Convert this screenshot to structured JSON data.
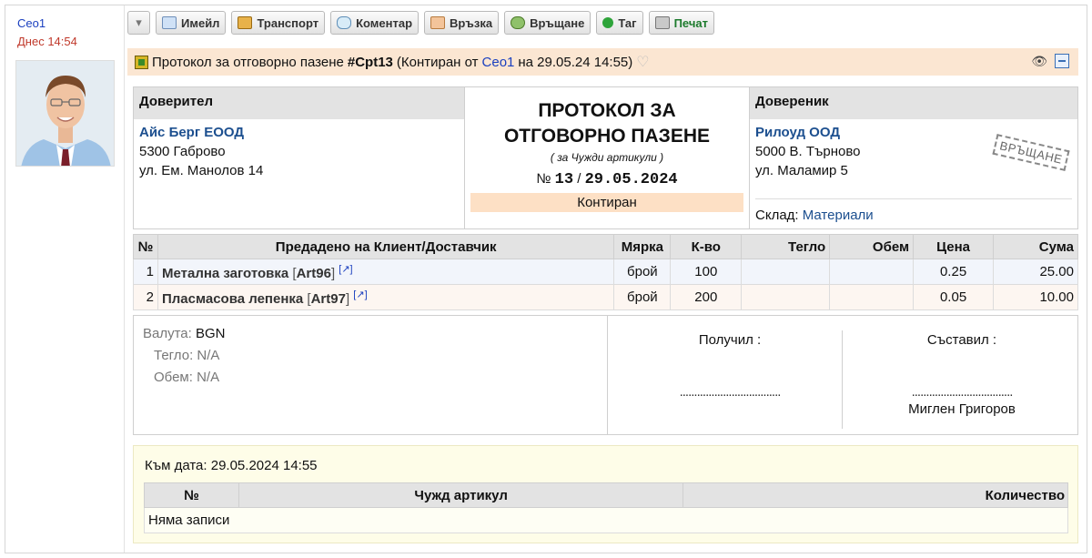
{
  "sidebar": {
    "author": "Сео1",
    "time": "Днес 14:54"
  },
  "toolbar": {
    "email": "Имейл",
    "transport": "Транспорт",
    "comment": "Коментар",
    "link": "Връзка",
    "return": "Връщане",
    "tag": "Таг",
    "print": "Печат"
  },
  "banner": {
    "prefix": "Протокол за отговорно пазене",
    "doc_id": "#Cpt13",
    "status_pre": "(Контиран от",
    "user": "Сео1",
    "status_post": "на 29.05.24 14:55)"
  },
  "consignor": {
    "head": "Доверител",
    "name": "Айс Берг ЕООД",
    "city": "5300 Габрово",
    "street": "ул. Ем. Манолов 14"
  },
  "consignee": {
    "head": "Довереник",
    "name": "Рилоуд ООД",
    "city": "5000 В. Търново",
    "street": "ул. Маламир 5",
    "store_label": "Склад:",
    "store_value": "Материали",
    "stamp": "ВРЪЩАНЕ"
  },
  "doc": {
    "title_line1": "ПРОТОКОЛ ЗА",
    "title_line2": "ОТГОВОРНО ПАЗЕНЕ",
    "subtitle": "( за Чужди артикули )",
    "number_prefix": "№",
    "number": "13",
    "sep": "/",
    "date": "29.05.2024",
    "status": "Контиран"
  },
  "items": {
    "headers": [
      "№",
      "Предадено на Клиент/Доставчик",
      "Мярка",
      "К-во",
      "Тегло",
      "Обем",
      "Цена",
      "Сума"
    ],
    "rows": [
      {
        "n": "1",
        "name": "Метална заготовка",
        "code": "Art96",
        "unit": "брой",
        "qty": "100",
        "weight": "",
        "volume": "",
        "price": "0.25",
        "sum": "25.00"
      },
      {
        "n": "2",
        "name": "Пласмасова лепенка",
        "code": "Art97",
        "unit": "брой",
        "qty": "200",
        "weight": "",
        "volume": "",
        "price": "0.05",
        "sum": "10.00"
      }
    ]
  },
  "meta": {
    "currency_label": "Валута:",
    "currency": "BGN",
    "weight_label": "Тегло:",
    "weight": "N/A",
    "volume_label": "Обем:",
    "volume": "N/A"
  },
  "signatures": {
    "received": "Получил :",
    "received_dots": "...................................",
    "composed": "Съставил :",
    "composed_dots": "...................................",
    "composer_name": "Миглен Григоров"
  },
  "lower": {
    "date_label": "Към дата: 29.05.2024 14:55",
    "col_no": "№",
    "col_item": "Чужд артикул",
    "col_qty": "Количество",
    "empty": "Няма записи"
  },
  "colors": {
    "link": "#1a3fbf",
    "banner_bg": "#fbe6d2",
    "status_bg": "#fde0c5",
    "lower_bg": "#fefde8"
  }
}
